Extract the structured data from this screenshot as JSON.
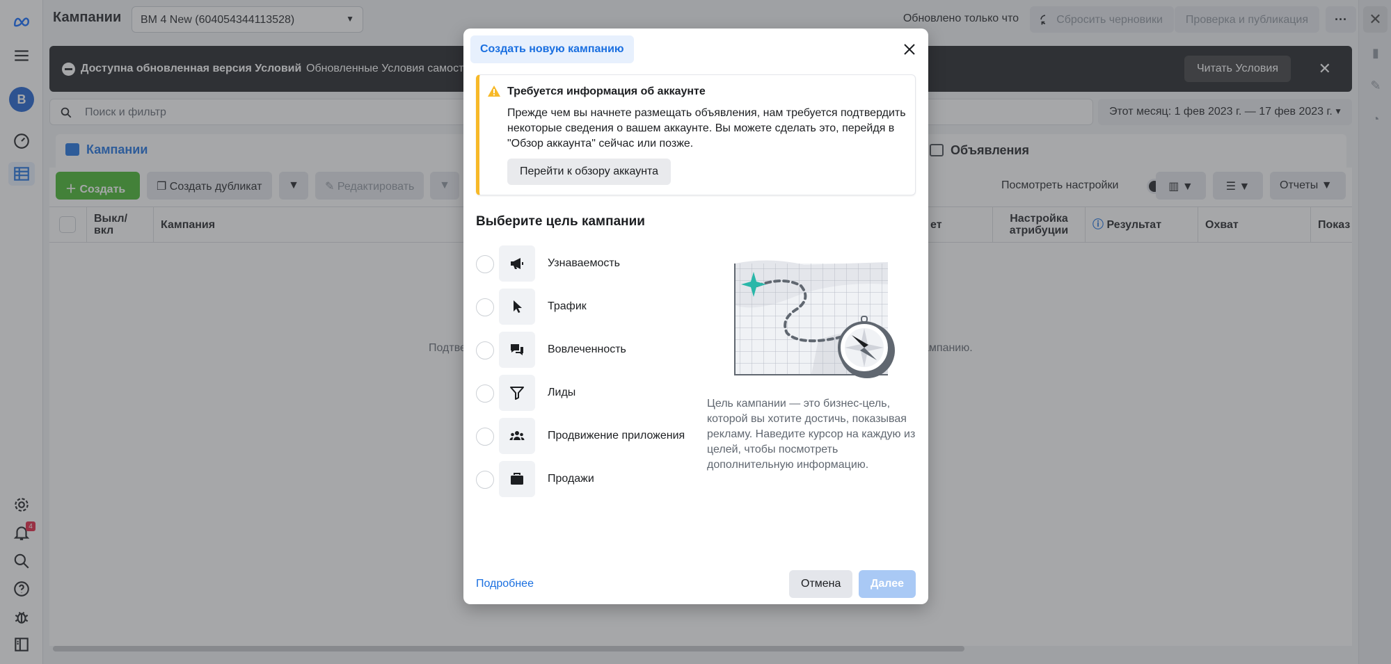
{
  "header": {
    "title": "Кампании",
    "account_selector": "BM 4 New (604054344113528)",
    "status": "Обновлено только что",
    "discard_drafts": "Сбросить черновики",
    "review_publish": "Проверка и публикация",
    "more": "···"
  },
  "notification_badge": "4",
  "avatar_letter": "B",
  "banner": {
    "title": "Доступна обновленная версия Условий",
    "text": "Обновленные Условия самостоя",
    "read_button": "Читать Условия"
  },
  "search": {
    "placeholder": "Поиск и фильтр",
    "date_range": "Этот месяц: 1 фев 2023 г. — 17 фев 2023 г."
  },
  "tabs": {
    "campaigns": "Кампании",
    "ads": "Объявления"
  },
  "toolbar": {
    "create": "Создать",
    "duplicate": "Создать дубликат",
    "edit": "Редактировать",
    "view_settings": "Посмотреть настройки",
    "reports": "Отчеты"
  },
  "table": {
    "columns": {
      "toggle": "Выкл/ вкл",
      "campaign": "Кампания",
      "budget_partial": "ет",
      "attribution": "Настройка атрибуции",
      "result": "Результат",
      "reach": "Охват",
      "impressions_partial": "Показ"
    },
    "empty_left": "Подтве",
    "empty_right": "ампанию."
  },
  "modal": {
    "tab": "Создать новую кампанию",
    "alert": {
      "title": "Требуется информация об аккаунте",
      "body": "Прежде чем вы начнете размещать объявления, нам требуется подтвердить некоторые сведения о вашем аккаунте. Вы можете сделать это, перейдя в \"Обзор аккаунта\" сейчас или позже.",
      "button": "Перейти к обзору аккаунта"
    },
    "heading": "Выберите цель кампании",
    "objectives": [
      {
        "label": "Узнаваемость",
        "icon": "megaphone-icon"
      },
      {
        "label": "Трафик",
        "icon": "cursor-icon"
      },
      {
        "label": "Вовлеченность",
        "icon": "chat-bubbles-icon"
      },
      {
        "label": "Лиды",
        "icon": "funnel-icon"
      },
      {
        "label": "Продвижение приложения",
        "icon": "people-icon"
      },
      {
        "label": "Продажи",
        "icon": "briefcase-icon"
      }
    ],
    "description": "Цель кампании — это бизнес-цель, которой вы хотите достичь, показывая рекламу. Наведите курсор на каждую из целей, чтобы посмотреть дополнительную информацию.",
    "learn_more": "Подробнее",
    "cancel": "Отмена",
    "next": "Далее"
  },
  "colors": {
    "accent": "#1a6fe0",
    "create_green": "#42b72a",
    "warning": "#f7b928",
    "next_disabled": "#a9c9f5"
  }
}
